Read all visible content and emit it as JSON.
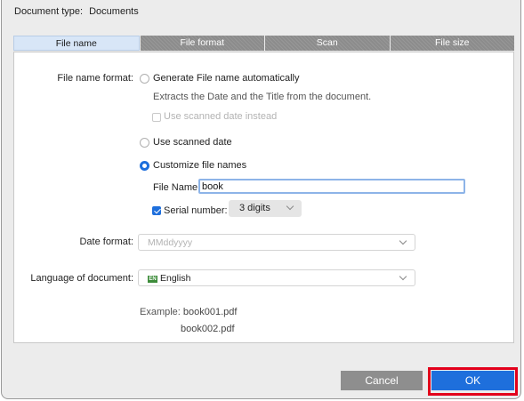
{
  "header": {
    "doc_type_label": "Document type:",
    "doc_type_value": "Documents"
  },
  "tabs": [
    {
      "label": "File name",
      "active": true
    },
    {
      "label": "File format",
      "active": false
    },
    {
      "label": "Scan",
      "active": false
    },
    {
      "label": "File size",
      "active": false
    }
  ],
  "file_name": {
    "format_label": "File name format:",
    "option_auto": "Generate File name automatically",
    "auto_description": "Extracts the Date and the Title from the document.",
    "use_scanned_date_instead": "Use scanned date instead",
    "option_scanned_date": "Use scanned date",
    "option_custom": "Customize file names",
    "file_name_label": "File Name:",
    "file_name_value": "book",
    "serial_label": "Serial number:",
    "serial_value": "3 digits",
    "selected_option": "custom"
  },
  "date_format": {
    "label": "Date format:",
    "value": "MMddyyyy"
  },
  "language": {
    "label": "Language of document:",
    "flag_text": "EN",
    "value": "English"
  },
  "example": {
    "label": "Example:",
    "line1": "book001.pdf",
    "line2": "book002.pdf"
  },
  "buttons": {
    "cancel": "Cancel",
    "ok": "OK"
  },
  "colors": {
    "accent": "#1e6fdc",
    "highlight_frame": "#e3001b",
    "tab_inactive": "#8c8c8c",
    "tab_active": "#d8e6f7"
  }
}
